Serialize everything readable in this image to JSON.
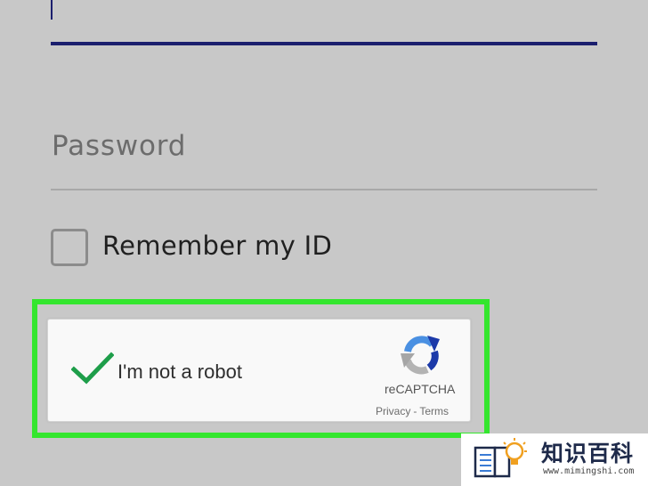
{
  "login_form": {
    "username_value": "",
    "password_placeholder": "Password",
    "remember_label": "Remember my ID",
    "remember_checked": false
  },
  "recaptcha": {
    "label": "I'm not a robot",
    "brand": "reCAPTCHA",
    "privacy_link": "Privacy",
    "separator": "-",
    "terms_link": "Terms",
    "checked": true,
    "check_color": "#1e9e4a",
    "logo_icon": "recaptcha-logo-icon"
  },
  "highlight": {
    "color": "#34e62e"
  },
  "colors": {
    "background": "#c8c8c8",
    "focus_underline": "#1b1f6e"
  },
  "watermark": {
    "title": "知识百科",
    "url": "www.mimingshi.com"
  }
}
